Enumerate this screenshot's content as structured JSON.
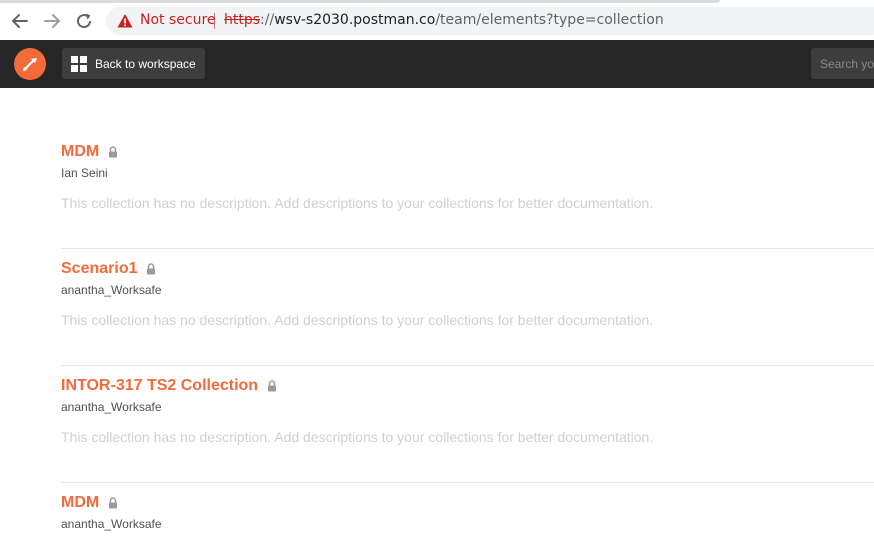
{
  "browser": {
    "security_label": "Not secure",
    "url_scheme": "https",
    "url_sep": "://",
    "url_host": "wsv-s2030.postman.co",
    "url_path": "/team/elements?type=collection"
  },
  "header": {
    "back_label": "Back to workspace",
    "search_placeholder": "Search yo"
  },
  "collections": [
    {
      "title": "MDM",
      "owner": "Ian Seini",
      "description": "This collection has no description. Add descriptions to your collections for better documentation."
    },
    {
      "title": "Scenario1",
      "owner": "anantha_Worksafe",
      "description": "This collection has no description. Add descriptions to your collections for better documentation."
    },
    {
      "title": "INTOR-317 TS2 Collection",
      "owner": "anantha_Worksafe",
      "description": "This collection has no description. Add descriptions to your collections for better documentation."
    },
    {
      "title": "MDM",
      "owner": "anantha_Worksafe",
      "description": ""
    }
  ],
  "colors": {
    "accent": "#f26b3a",
    "appbar": "#262626",
    "warning": "#c5221f"
  }
}
